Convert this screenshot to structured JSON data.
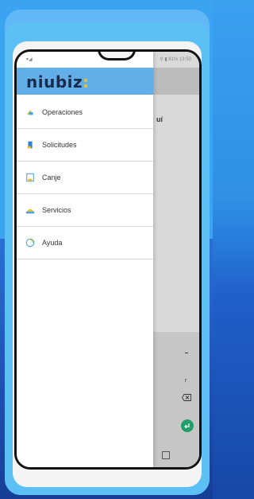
{
  "app": {
    "logo_text": "niubiz",
    "logo_dot": ":",
    "brand_colors": {
      "header": "#62aee8",
      "logo": "#1a2b4c",
      "accent": "#f3c21a"
    }
  },
  "status_bar": {
    "left_icons": "▾◢",
    "right_text": "⚲ ▮ 81% 13:50"
  },
  "menu": {
    "items": [
      {
        "label": "Operaciones",
        "icon": "operations-icon"
      },
      {
        "label": "Solicitudes",
        "icon": "requests-icon"
      },
      {
        "label": "Canje",
        "icon": "exchange-icon"
      },
      {
        "label": "Servicios",
        "icon": "services-icon"
      },
      {
        "label": "Ayuda",
        "icon": "help-icon"
      }
    ]
  },
  "background_screen": {
    "partial_text": "uí",
    "keypad_dash": "-",
    "keypad_r": "r"
  }
}
